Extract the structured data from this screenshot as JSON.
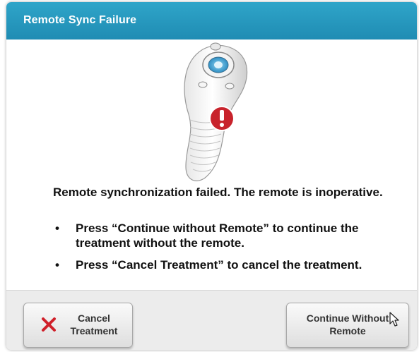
{
  "dialog": {
    "title": "Remote Sync Failure"
  },
  "illustration": {
    "icon": "remote-warning-icon",
    "alert_color": "#c8232c"
  },
  "message": {
    "text": "Remote synchronization failed.  The remote is inoperative."
  },
  "bullets": [
    {
      "mark": "•",
      "text": "Press “Continue without Remote” to continue the treatment without the remote."
    },
    {
      "mark": "•",
      "text": "Press “Cancel Treatment” to cancel the treatment."
    }
  ],
  "buttons": {
    "cancel": {
      "label": "Cancel\nTreatment",
      "icon": "x-icon",
      "icon_color": "#d0202a"
    },
    "continue": {
      "label": "Continue Without\nRemote"
    }
  },
  "colors": {
    "titlebar": "#2596be",
    "footer": "#ececec"
  }
}
